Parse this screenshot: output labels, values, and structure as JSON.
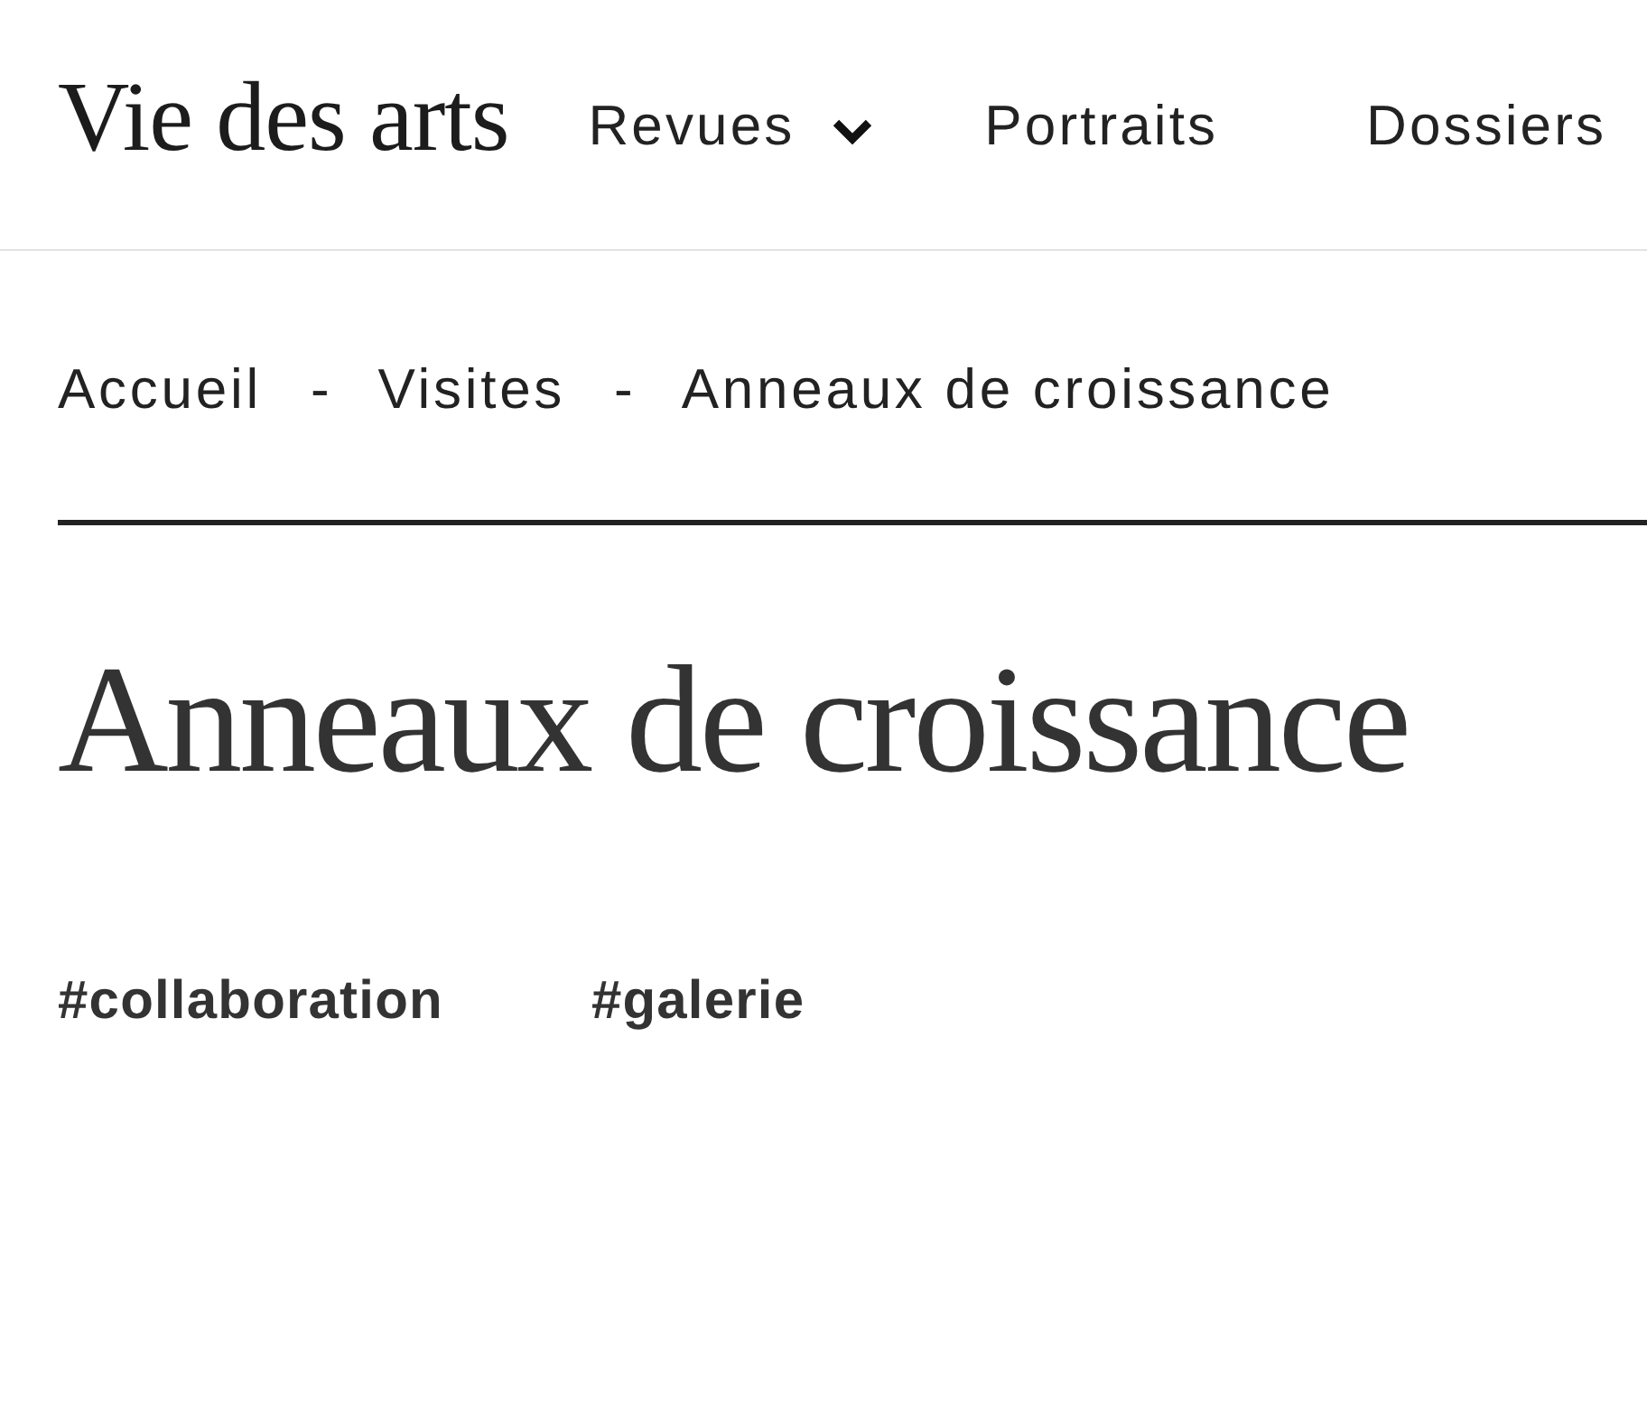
{
  "header": {
    "logo": "Vie des arts",
    "nav": [
      {
        "label": "Revues",
        "has_dropdown": true
      },
      {
        "label": "Portraits",
        "has_dropdown": false
      },
      {
        "label": "Dossiers",
        "has_dropdown": false
      }
    ]
  },
  "breadcrumb": {
    "items": [
      "Accueil",
      "Visites",
      "Anneaux de croissance"
    ],
    "separators": [
      "-",
      "-"
    ]
  },
  "article": {
    "title": "Anneaux de croissance",
    "tags": [
      "#collaboration",
      "#galerie"
    ]
  }
}
